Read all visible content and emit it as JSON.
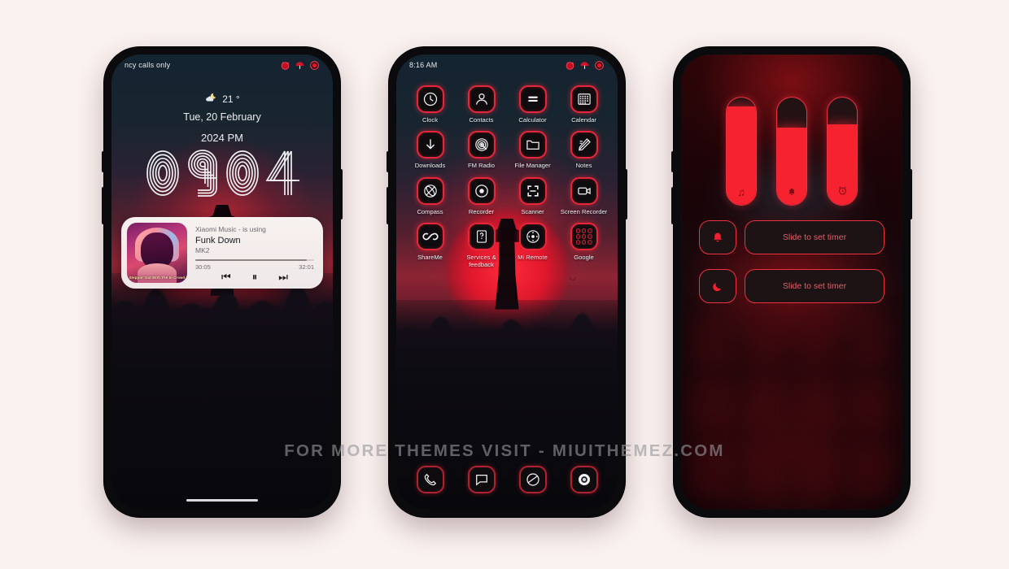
{
  "theme": {
    "accent": "#e8263a",
    "accent_bright": "#f7222f",
    "page_background": "#faf2f0",
    "screen_dark": "#0d1a22"
  },
  "watermark": "FOR MORE THEMES VISIT - MIUITHEMEZ.COM",
  "phone1": {
    "statusbar": {
      "carrier": "ncy calls only",
      "icons": [
        "signal-icon",
        "wifi-icon",
        "battery-icon"
      ]
    },
    "lockscreen": {
      "weather_icon": "moon-cloud-icon",
      "temperature": "21 °",
      "date": "Tue, 20 February",
      "year_period": "2024 PM",
      "clock_digits": [
        "0",
        "9",
        "0",
        "4"
      ]
    },
    "music": {
      "app_line": "Xiaomi Music - is using",
      "title": "Funk Down",
      "artist": "MK2",
      "elapsed": "30:05",
      "duration": "32:01",
      "progress_percent": 94,
      "album_caption": "Steppin' Out With The In Crowd",
      "controls": [
        {
          "name": "previous-button",
          "glyph": "⏮"
        },
        {
          "name": "pause-button",
          "glyph": "⏸"
        },
        {
          "name": "next-button",
          "glyph": "⏭"
        }
      ]
    }
  },
  "phone2": {
    "statusbar": {
      "time": "8:16 AM",
      "icons": [
        "signal-icon",
        "wifi-icon",
        "battery-icon"
      ]
    },
    "apps": [
      {
        "label": "Clock",
        "icon": "clock-icon"
      },
      {
        "label": "Contacts",
        "icon": "contacts-icon"
      },
      {
        "label": "Calculator",
        "icon": "calculator-icon"
      },
      {
        "label": "Calendar",
        "icon": "calendar-icon"
      },
      {
        "label": "Downloads",
        "icon": "download-arrow-icon"
      },
      {
        "label": "FM Radio",
        "icon": "fm-radio-icon"
      },
      {
        "label": "File Manager",
        "icon": "folder-icon"
      },
      {
        "label": "Notes",
        "icon": "pencil-note-icon"
      },
      {
        "label": "Compass",
        "icon": "compass-icon"
      },
      {
        "label": "Recorder",
        "icon": "recorder-icon"
      },
      {
        "label": "Scanner",
        "icon": "scanner-frame-icon"
      },
      {
        "label": "Screen Recorder",
        "icon": "video-camera-icon"
      },
      {
        "label": "ShareMe",
        "icon": "infinity-icon"
      },
      {
        "label": "Services & feedback",
        "icon": "feedback-doc-icon"
      },
      {
        "label": "Mi Remote",
        "icon": "remote-dpad-icon"
      },
      {
        "label": "Google",
        "icon": "google-folder-icon"
      }
    ],
    "dock": [
      {
        "label": "Phone",
        "icon": "phone-handset-icon"
      },
      {
        "label": "Messages",
        "icon": "message-bubble-icon"
      },
      {
        "label": "Browser",
        "icon": "browser-globe-icon"
      },
      {
        "label": "Camera",
        "icon": "camera-lens-icon"
      }
    ]
  },
  "phone3": {
    "sliders": [
      {
        "name": "media-volume-slider",
        "icon": "music-note-icon",
        "glyph": "♫",
        "level_percent": 92
      },
      {
        "name": "ring-volume-slider",
        "icon": "bell-icon",
        "glyph": "ὑ4",
        "level_percent": 72
      },
      {
        "name": "alarm-volume-slider",
        "icon": "alarm-clock-icon",
        "glyph": "⏰",
        "level_percent": 75
      }
    ],
    "timers": [
      {
        "name": "silent-timer",
        "icon": "bell-icon",
        "glyph": "ὑ4",
        "label": "Slide to set timer"
      },
      {
        "name": "dnd-timer",
        "icon": "moon-icon",
        "glyph": "☾",
        "label": "Slide to set timer"
      }
    ]
  }
}
